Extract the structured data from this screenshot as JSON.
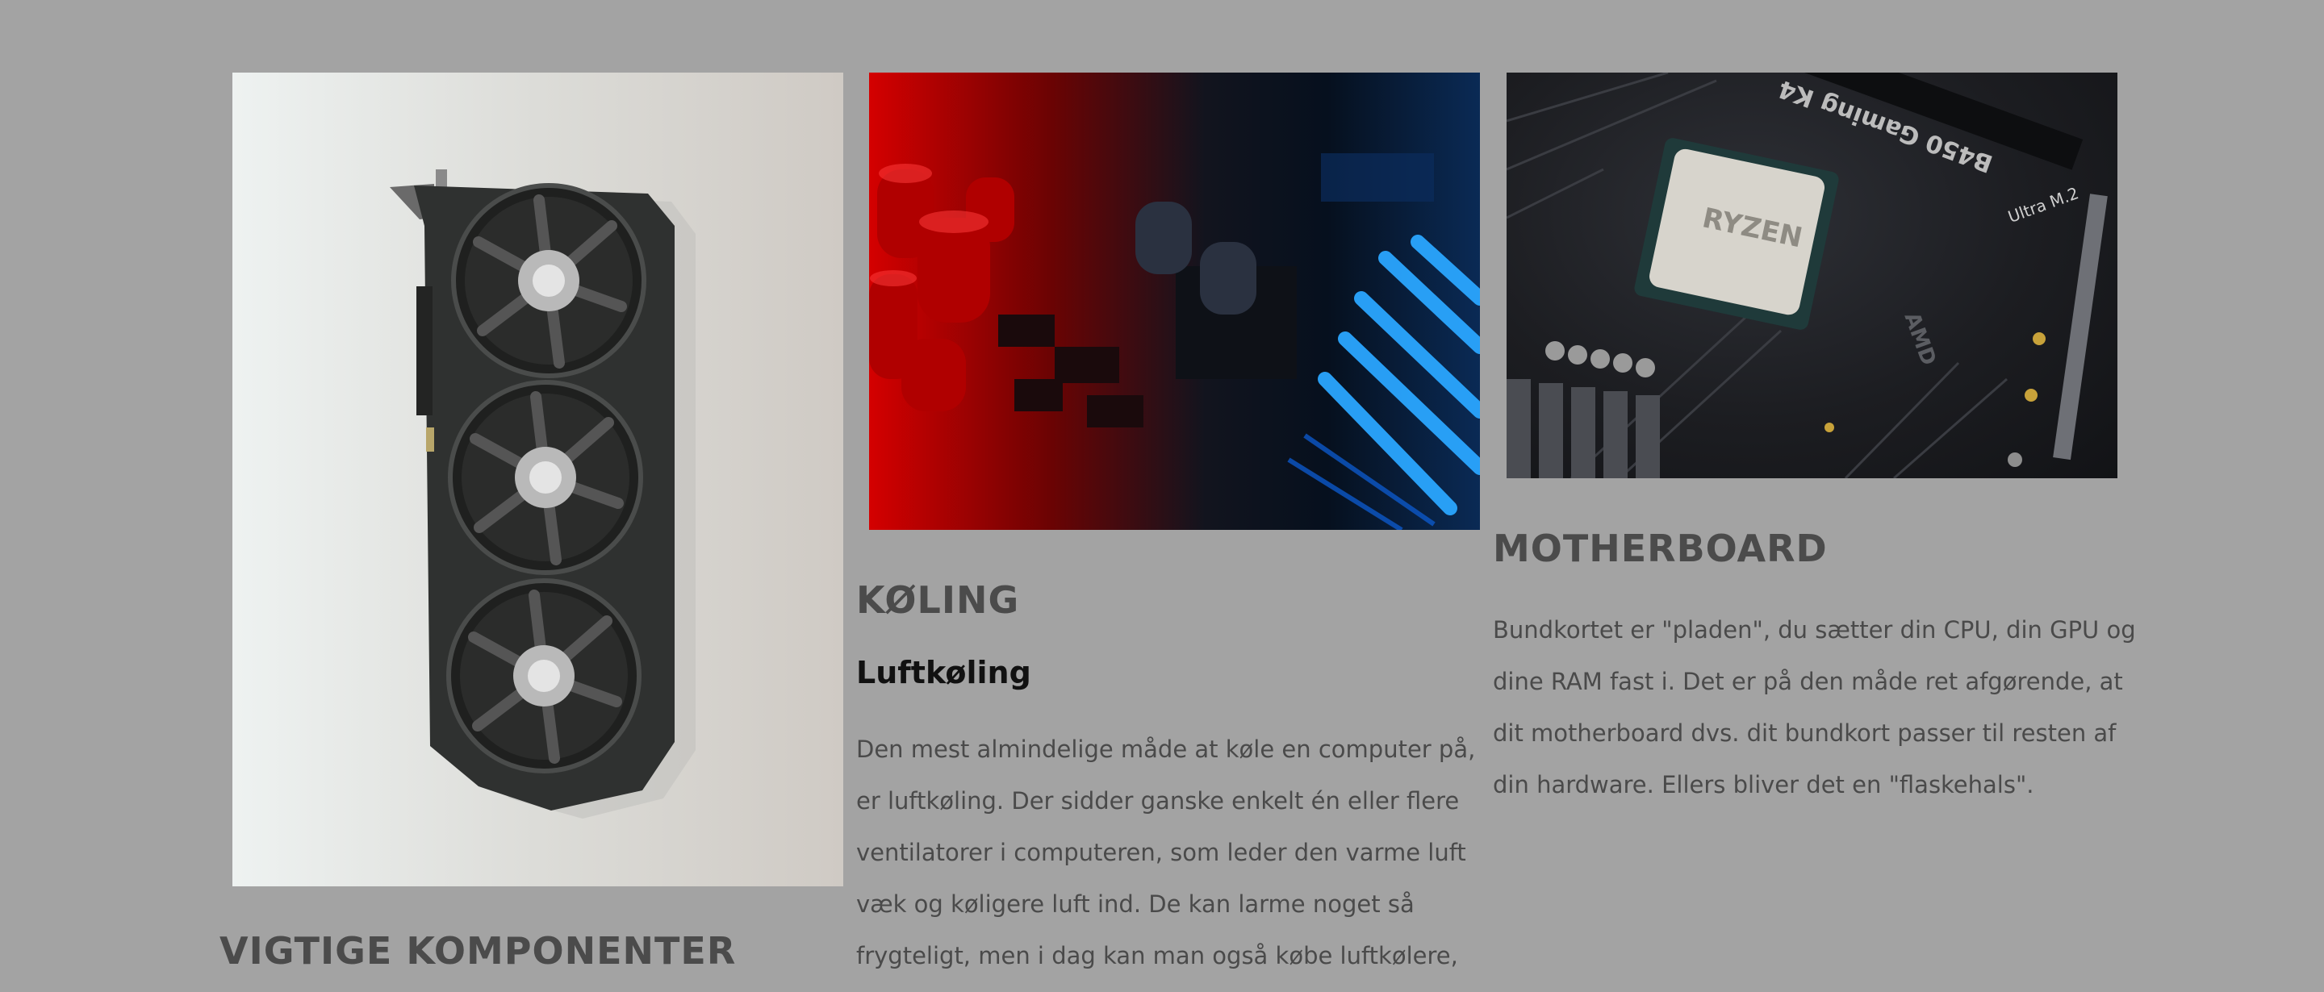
{
  "sections": {
    "components": {
      "image_alt": "graphics-card-photo",
      "heading": "VIGTIGE KOMPONENTER"
    },
    "cooling": {
      "image_alt": "cooling-photo",
      "heading": "KØLING",
      "subheading": "Luftkøling",
      "body": "Den mest almindelige måde at køle en computer på, er luftkøling. Der sidder ganske enkelt én eller flere ventilatorer i computeren, som leder den varme luft væk og køligere luft ind. De kan larme noget så frygteligt, men i dag kan man også købe luftkølere, der"
    },
    "motherboard": {
      "image_alt": "motherboard-photo",
      "heading": "MOTHERBOARD",
      "body": "Bundkortet er \"pladen\", du sætter din CPU, din GPU og dine RAM fast i. Det er på den måde ret afgørende, at dit motherboard dvs. dit bundkort passer til resten af din hardware. Ellers bliver det en \"flaskehals\".",
      "board_text": {
        "model": "B450 Gaming K4",
        "cpu_brand": "RYZEN",
        "slot_label": "Ultra M.2",
        "chip_brand": "AMD"
      }
    }
  },
  "colors": {
    "page_background": "#a3a3a3",
    "heading_grey": "#4b4b4b",
    "subheading_black": "#111111",
    "body_text": "#4a4a4a"
  }
}
